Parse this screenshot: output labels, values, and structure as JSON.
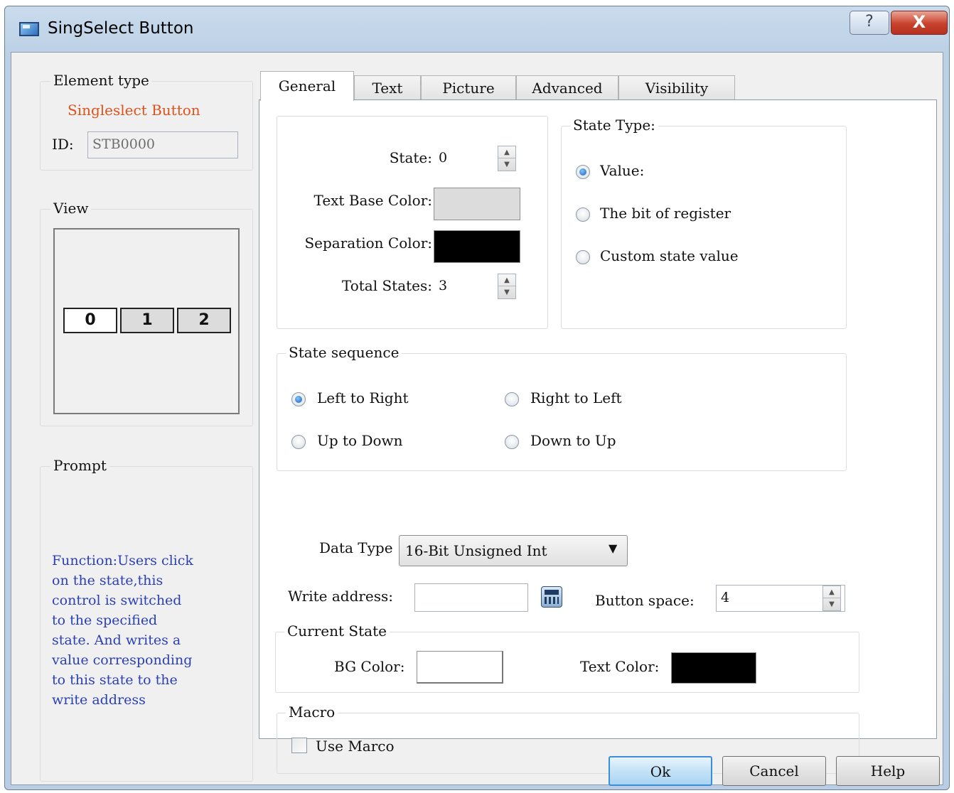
{
  "window": {
    "title": "SingSelect Button",
    "help_glyph": "?",
    "close_glyph": "X"
  },
  "element_type": {
    "group_title": "Element type",
    "name": "Singleslect Button",
    "name_color": "#e0521c",
    "id_label": "ID:",
    "id_value": "STB0000"
  },
  "view": {
    "group_title": "View",
    "cells": [
      "0",
      "1",
      "2"
    ]
  },
  "prompt": {
    "group_title": "Prompt",
    "lines": [
      "Function:Users click",
      "on the state,this",
      "control is switched",
      "to the specified",
      "state. And writes a",
      "value corresponding",
      "to this state to the",
      "write address"
    ],
    "color": "#2a3fb8"
  },
  "tabs": [
    "General",
    "Text",
    "Picture",
    "Advanced",
    "Visibility"
  ],
  "general": {
    "state_label": "State:",
    "state_value": "0",
    "text_base_color_label": "Text Base Color:",
    "separation_color_label": "Separation Color:",
    "total_states_label": "Total States:",
    "total_states_value": "3",
    "text_base_color": "#dcdcdc",
    "separation_color": "#000000"
  },
  "state_type": {
    "group_title": "State Type:",
    "options": [
      "Value:",
      "The bit of register",
      "Custom state value"
    ],
    "selected": 0
  },
  "state_sequence": {
    "group_title": "State sequence",
    "options": [
      "Left to Right",
      "Right to Left",
      "Up to Down",
      "Down to Up"
    ],
    "selected": 0
  },
  "data_type": {
    "label": "Data Type",
    "value": "16-Bit Unsigned Int"
  },
  "write_address": {
    "label": "Write address:",
    "value": ""
  },
  "button_space": {
    "label": "Button space:",
    "value": "4"
  },
  "current_state": {
    "group_title": "Current State",
    "bg_color_label": "BG Color:",
    "text_color_label": "Text Color:",
    "bg_color": "#ffffff",
    "text_color": "#000000"
  },
  "macro": {
    "group_title": "Macro",
    "use_macro_label": "Use Marco",
    "checked": false
  },
  "buttons": {
    "ok": "Ok",
    "cancel": "Cancel",
    "help": "Help"
  }
}
